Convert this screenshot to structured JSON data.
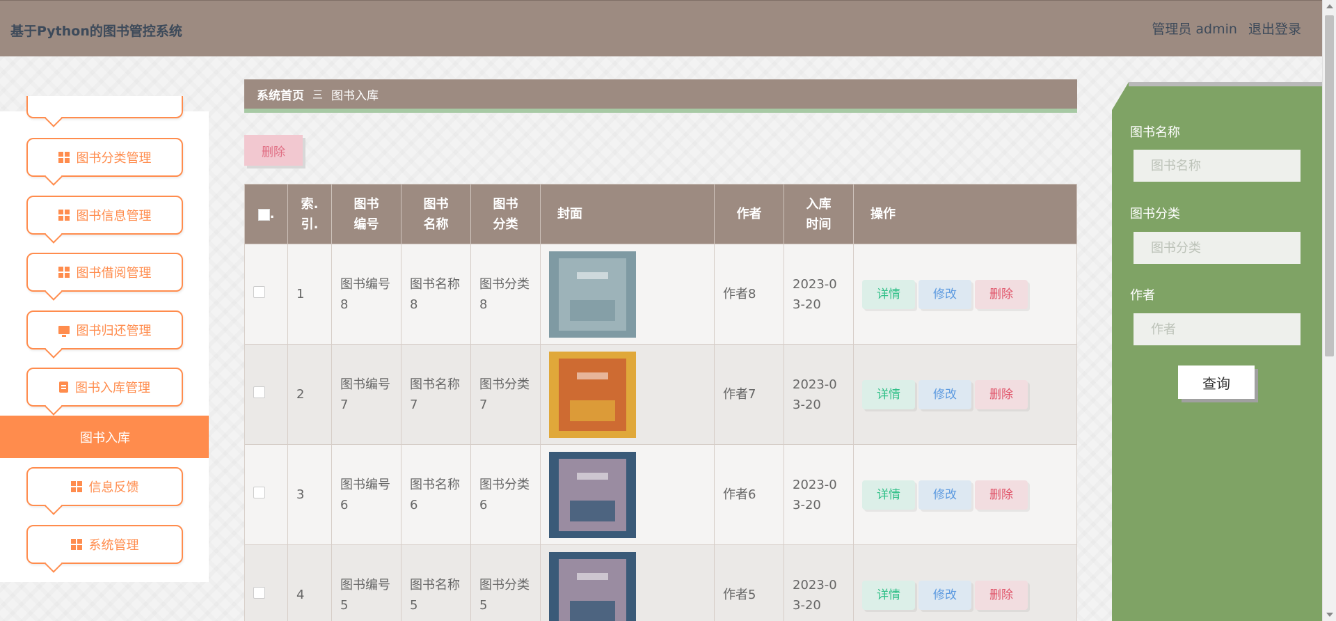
{
  "app": {
    "title": "基于Python的图书管控系统",
    "user_label": "管理员 admin",
    "logout_label": "退出登录"
  },
  "sidebar": {
    "items": [
      {
        "label": "图书分类管理",
        "icon": "grid-icon"
      },
      {
        "label": "图书信息管理",
        "icon": "grid-icon"
      },
      {
        "label": "图书借阅管理",
        "icon": "grid-icon"
      },
      {
        "label": "图书归还管理",
        "icon": "monitor-icon"
      },
      {
        "label": "图书入库管理",
        "icon": "clipboard-icon"
      },
      {
        "label": "信息反馈",
        "icon": "grid-icon"
      },
      {
        "label": "系统管理",
        "icon": "grid-icon"
      }
    ],
    "active_item": "图书入库"
  },
  "breadcrumb": {
    "home": "系统首页",
    "separator": "三",
    "current": "图书入库"
  },
  "toolbar": {
    "delete_label": "删除"
  },
  "table": {
    "headers": {
      "index": "索.\n引.",
      "book_no": "图书\n编号",
      "book_name": "图书\n名称",
      "category": "图书\n分类",
      "cover": "封面",
      "author": "作者",
      "date": "入库\n时间",
      "ops": "操作"
    },
    "rows": [
      {
        "index": "1",
        "book_no": "图书编号8",
        "book_name": "图书名称8",
        "category": "图书分类8",
        "author": "作者8",
        "date": "2023-03-20",
        "cover_colors": [
          "#7f9aa3",
          "#b7c9cc"
        ]
      },
      {
        "index": "2",
        "book_no": "图书编号7",
        "book_name": "图书名称7",
        "category": "图书分类7",
        "author": "作者7",
        "date": "2023-03-20",
        "cover_colors": [
          "#e0a83a",
          "#c0392b"
        ]
      },
      {
        "index": "3",
        "book_no": "图书编号6",
        "book_name": "图书名称6",
        "category": "图书分类6",
        "author": "作者6",
        "date": "2023-03-20",
        "cover_colors": [
          "#3a5a78",
          "#e9b7c2"
        ]
      },
      {
        "index": "4",
        "book_no": "图书编号5",
        "book_name": "图书名称5",
        "category": "图书分类5",
        "author": "作者5",
        "date": "2023-03-20",
        "cover_colors": [
          "#3a5a78",
          "#e9b7c2"
        ]
      }
    ],
    "actions": {
      "detail": "详情",
      "edit": "修改",
      "delete": "删除"
    }
  },
  "search": {
    "name_label": "图书名称",
    "name_placeholder": "图书名称",
    "category_label": "图书分类",
    "category_placeholder": "图书分类",
    "author_label": "作者",
    "author_placeholder": "作者",
    "query_button": "查询"
  },
  "colors": {
    "header_bg": "#9d8b81",
    "accent_orange": "#ff8c4d",
    "panel_green": "#7fa365"
  }
}
